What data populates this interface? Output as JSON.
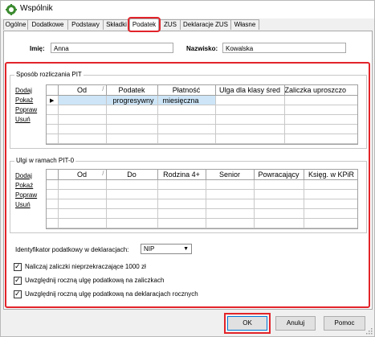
{
  "window": {
    "title": "Wspólnik"
  },
  "tabs": [
    "Ogólne",
    "Dodatkowe",
    "Podstawy",
    "Składki",
    "Podatek",
    "ZUS",
    "Deklaracje ZUS",
    "Własne"
  ],
  "person": {
    "first_name_label": "Imię:",
    "first_name_value": "Anna",
    "last_name_label": "Nazwisko:",
    "last_name_value": "Kowalska"
  },
  "pit_group": {
    "title": "Sposób rozliczania PIT",
    "links": [
      "Dodaj",
      "Pokaż",
      "Popraw",
      "Usuń"
    ],
    "columns": [
      "Od",
      "Podatek",
      "Płatność",
      "Ulga dla klasy śred",
      "Zaliczka uproszczo"
    ],
    "rows": [
      [
        "",
        "progresywny",
        "miesięczna",
        "",
        ""
      ]
    ]
  },
  "ulgi_group": {
    "title": "Ulgi w ramach PIT-0",
    "links": [
      "Dodaj",
      "Pokaż",
      "Popraw",
      "Usuń"
    ],
    "columns": [
      "Od",
      "Do",
      "Rodzina 4+",
      "Senior",
      "Powracający",
      "Księg. w KPiR"
    ]
  },
  "tax_id": {
    "label": "Identyfikator podatkowy w deklaracjach:",
    "value": "NIP"
  },
  "checkboxes": [
    {
      "label": "Naliczaj zaliczki nieprzekraczające 1000 zł",
      "checked": true
    },
    {
      "label": "Uwzględnij roczną ulgę podatkową na zaliczkach",
      "checked": true
    },
    {
      "label": "Uwzględnij roczną ulgę podatkową na deklaracjach rocznych",
      "checked": true
    }
  ],
  "buttons": {
    "ok": "OK",
    "cancel": "Anuluj",
    "help": "Pomoc"
  },
  "colors": {
    "highlight": "#e2242a",
    "selected_row": "#cde5f7",
    "app_icon": "#3a8a2e"
  }
}
